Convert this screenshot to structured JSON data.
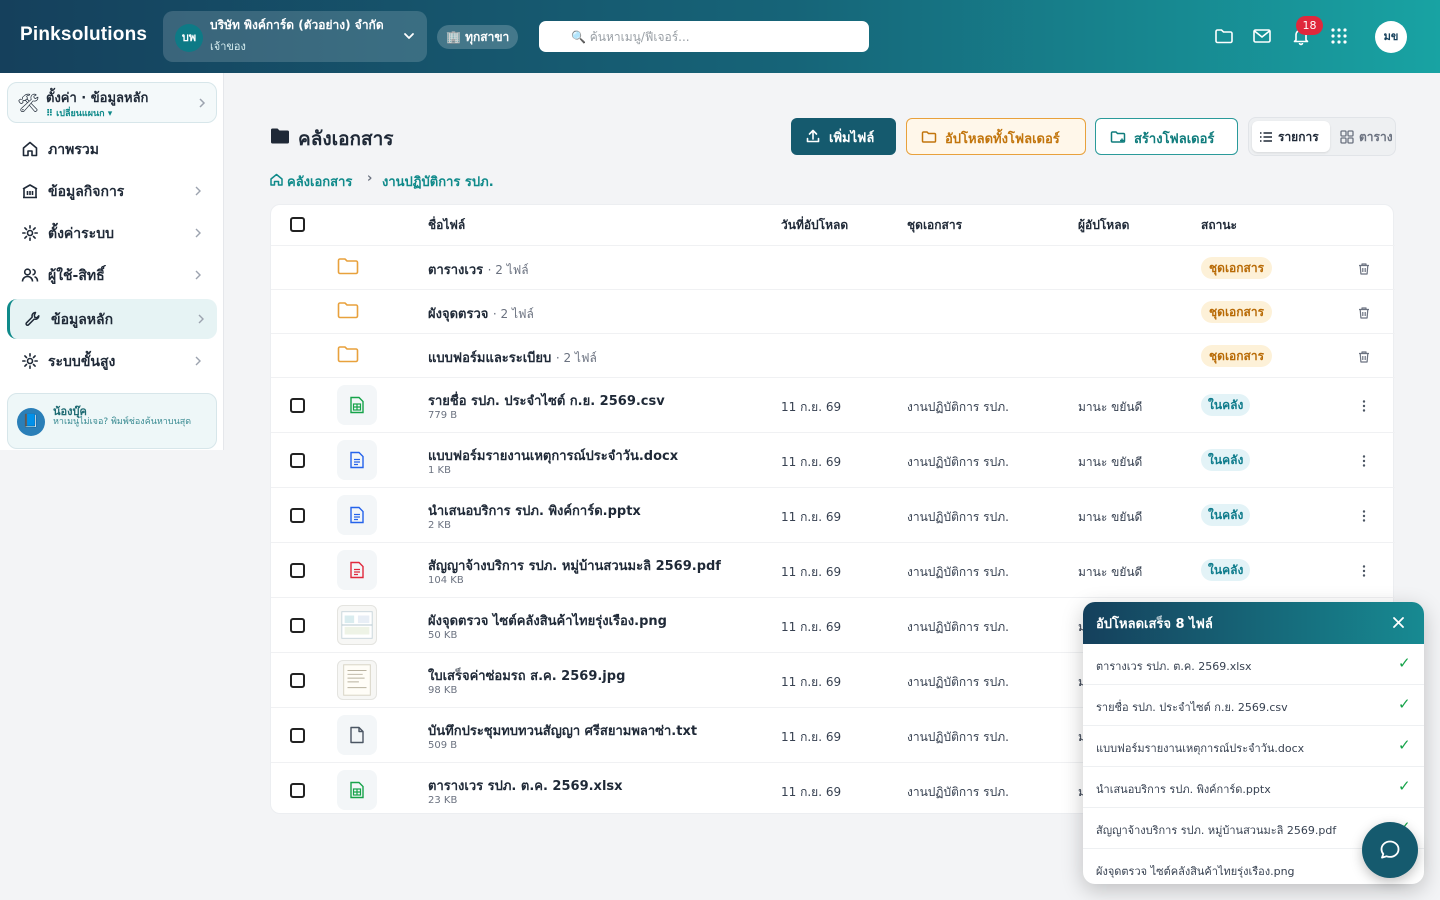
{
  "header": {
    "brand": "Pinksolutions",
    "company": {
      "initials": "บพ",
      "name": "บริษัท พิงค์การ์ด (ตัวอย่าง) จำกัด",
      "role": "เจ้าของ"
    },
    "branch_label": "🏢 ทุกสาขา",
    "search_placeholder": "🔍 ค้นหาเมนู/ฟีเจอร์...",
    "notification_count": "18",
    "user_initials": "มข"
  },
  "sidebar": {
    "settings_title": "ตั้งค่า · ข้อมูลหลัก",
    "settings_sub": "⠿ เปลี่ยนแผนก ▾",
    "items": [
      {
        "label": "ภาพรวม",
        "icon": "home-icon",
        "has_chevron": false
      },
      {
        "label": "ข้อมูลกิจการ",
        "icon": "building-icon",
        "has_chevron": true
      },
      {
        "label": "ตั้งค่าระบบ",
        "icon": "gear-icon",
        "has_chevron": true
      },
      {
        "label": "ผู้ใช้-สิทธิ์",
        "icon": "users-icon",
        "has_chevron": true
      },
      {
        "label": "ข้อมูลหลัก",
        "icon": "wrench-icon",
        "has_chevron": true,
        "active": true
      },
      {
        "label": "ระบบขั้นสูง",
        "icon": "gear-icon",
        "has_chevron": true
      }
    ],
    "help": {
      "title": "น้องบุ๊ค",
      "text": "หาเมนูไม่เจอ? พิมพ์ช่องค้นหาบนสุด"
    }
  },
  "main": {
    "title": "คลังเอกสาร",
    "buttons": {
      "add_file": "เพิ่มไฟล์",
      "upload_folder": "อัปโหลดทั้งโฟลเดอร์",
      "create_folder": "สร้างโฟลเดอร์"
    },
    "view": {
      "list": "รายการ",
      "grid": "ตาราง"
    },
    "breadcrumb": [
      "คลังเอกสาร",
      "›",
      "งานปฏิบัติการ รปภ."
    ],
    "columns": {
      "name": "ชื่อไฟล์",
      "uploaded": "วันที่อัปโหลด",
      "set": "ชุดเอกสาร",
      "uploader": "ผู้อัปโหลด",
      "status": "สถานะ"
    },
    "folders": [
      {
        "name": "ตารางเวร",
        "count": "· 2 ไฟล์",
        "status": "ชุดเอกสาร"
      },
      {
        "name": "ผังจุดตรวจ",
        "count": "· 2 ไฟล์",
        "status": "ชุดเอกสาร"
      },
      {
        "name": "แบบฟอร์มและระเบียบ",
        "count": "· 2 ไฟล์",
        "status": "ชุดเอกสาร"
      }
    ],
    "files": [
      {
        "name": "รายชื่อ รปภ. ประจำไซต์ ก.ย. 2569.csv",
        "size": "779 B",
        "date": "11 ก.ย. 69",
        "set": "งานปฏิบัติการ รปภ.",
        "uploader": "มานะ ขยันดี",
        "status": "ในคลัง",
        "kind": "sheet"
      },
      {
        "name": "แบบฟอร์มรายงานเหตุการณ์ประจำวัน.docx",
        "size": "1 KB",
        "date": "11 ก.ย. 69",
        "set": "งานปฏิบัติการ รปภ.",
        "uploader": "มานะ ขยันดี",
        "status": "ในคลัง",
        "kind": "doc"
      },
      {
        "name": "นำเสนอบริการ รปภ. พิงค์การ์ด.pptx",
        "size": "2 KB",
        "date": "11 ก.ย. 69",
        "set": "งานปฏิบัติการ รปภ.",
        "uploader": "มานะ ขยันดี",
        "status": "ในคลัง",
        "kind": "doc"
      },
      {
        "name": "สัญญาจ้างบริการ รปภ. หมู่บ้านสวนมะลิ 2569.pdf",
        "size": "104 KB",
        "date": "11 ก.ย. 69",
        "set": "งานปฏิบัติการ รปภ.",
        "uploader": "มานะ ขยันดี",
        "status": "ในคลัง",
        "kind": "pdf"
      },
      {
        "name": "ผังจุดตรวจ ไซต์คลังสินค้าไทยรุ่งเรือง.png",
        "size": "50 KB",
        "date": "11 ก.ย. 69",
        "set": "งานปฏิบัติการ รปภ.",
        "uploader": "ม",
        "status": "",
        "kind": "img"
      },
      {
        "name": "ใบเสร็จค่าซ่อมรถ ส.ค. 2569.jpg",
        "size": "98 KB",
        "date": "11 ก.ย. 69",
        "set": "งานปฏิบัติการ รปภ.",
        "uploader": "ม",
        "status": "",
        "kind": "img2"
      },
      {
        "name": "บันทึกประชุมทบทวนสัญญา ศรีสยามพลาซ่า.txt",
        "size": "509 B",
        "date": "11 ก.ย. 69",
        "set": "งานปฏิบัติการ รปภ.",
        "uploader": "ม",
        "status": "",
        "kind": "txt"
      },
      {
        "name": "ตารางเวร รปภ. ต.ค. 2569.xlsx",
        "size": "23 KB",
        "date": "11 ก.ย. 69",
        "set": "งานปฏิบัติการ รปภ.",
        "uploader": "ม",
        "status": "",
        "kind": "sheet"
      }
    ]
  },
  "upload_panel": {
    "title": "อัปโหลดเสร็จ 8 ไฟล์",
    "items": [
      "ตารางเวร รปภ. ต.ค. 2569.xlsx",
      "รายชื่อ รปภ. ประจำไซต์ ก.ย. 2569.csv",
      "แบบฟอร์มรายงานเหตุการณ์ประจำวัน.docx",
      "นำเสนอบริการ รปภ. พิงค์การ์ด.pptx",
      "สัญญาจ้างบริการ รปภ. หมู่บ้านสวนมะลิ 2569.pdf",
      "ผังจุดตรวจ ไซต์คลังสินค้าไทยรุ่งเรือง.png"
    ],
    "check": "✓"
  },
  "colors": {
    "primary": "#155a6e",
    "accent": "#0f8a8a",
    "warning": "#c2750c",
    "success": "#16a34a",
    "danger": "#e0283c"
  }
}
